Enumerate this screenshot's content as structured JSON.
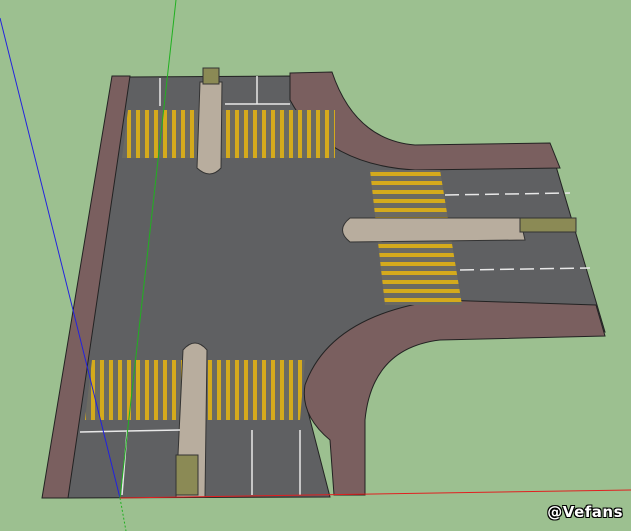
{
  "watermark": "@Vefans",
  "colors": {
    "background": "#9cc090",
    "road": "#5f6062",
    "sidewalk": "#7a5f5f",
    "crosswalk_yellow": "#d4aa1c",
    "median": "#b8ad9e",
    "axis_red": "#e02020",
    "axis_green": "#20b020",
    "axis_blue": "#2020e0"
  }
}
